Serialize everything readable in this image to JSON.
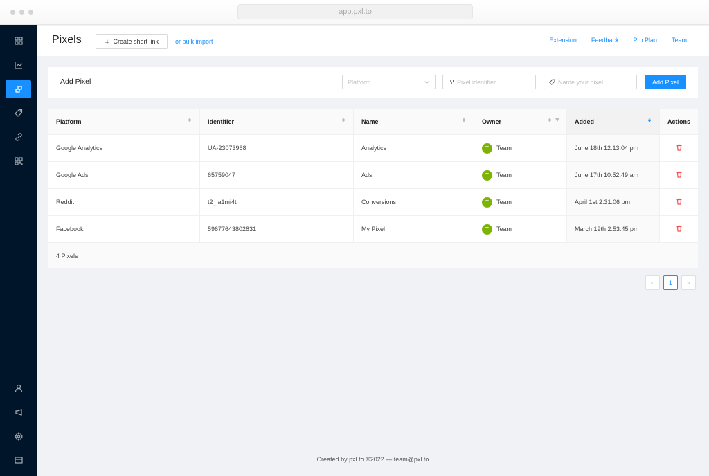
{
  "browser": {
    "url": "app.pxl.to"
  },
  "sidebar": {
    "items": [
      {
        "icon": "dashboard-icon",
        "active": false
      },
      {
        "icon": "analytics-chart-icon",
        "active": false
      },
      {
        "icon": "pixels-icon",
        "active": true
      },
      {
        "icon": "tag-icon",
        "active": false
      },
      {
        "icon": "link-icon",
        "active": false
      },
      {
        "icon": "qr-code-icon",
        "active": false
      }
    ],
    "bottom_items": [
      {
        "icon": "user-icon"
      },
      {
        "icon": "megaphone-icon"
      },
      {
        "icon": "settings-gear-icon"
      },
      {
        "icon": "billing-card-icon"
      }
    ]
  },
  "header": {
    "title": "Pixels",
    "create_button": "Create short link",
    "bulk_import": "or bulk import",
    "links": [
      "Extension",
      "Feedback",
      "Pro Plan",
      "Team"
    ]
  },
  "add_pixel": {
    "heading": "Add Pixel",
    "platform_placeholder": "Platform",
    "identifier_placeholder": "Pixel identifier",
    "name_placeholder": "Name your pixel",
    "button": "Add Pixel"
  },
  "table": {
    "columns": [
      "Platform",
      "Identifier",
      "Name",
      "Owner",
      "Added",
      "Actions"
    ],
    "rows": [
      {
        "platform": "Google Analytics",
        "identifier": "UA-23073968",
        "name": "Analytics",
        "owner_initial": "T",
        "owner": "Team",
        "added": "June 18th 12:13:04 pm"
      },
      {
        "platform": "Google Ads",
        "identifier": "65759047",
        "name": "Ads",
        "owner_initial": "T",
        "owner": "Team",
        "added": "June 17th 10:52:49 am"
      },
      {
        "platform": "Reddit",
        "identifier": "t2_la1mi4t",
        "name": "Conversions",
        "owner_initial": "T",
        "owner": "Team",
        "added": "April 1st 2:31:06 pm"
      },
      {
        "platform": "Facebook",
        "identifier": "59677643802831",
        "name": "My Pixel",
        "owner_initial": "T",
        "owner": "Team",
        "added": "March 19th 2:53:45 pm"
      }
    ],
    "summary": "4 Pixels"
  },
  "pagination": {
    "prev": "<",
    "current": "1",
    "next": ">"
  },
  "footer": {
    "text": "Created by pxl.to ©2022 — team@pxl.to"
  },
  "colors": {
    "accent": "#1890ff",
    "sidebar": "#001529",
    "avatar": "#7cb305",
    "danger": "#ff4d4f"
  }
}
